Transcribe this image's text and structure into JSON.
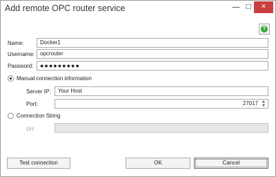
{
  "window": {
    "title": "Add remote OPC router service",
    "minimize_glyph": "—",
    "maximize_glyph": "□",
    "close_glyph": "✕"
  },
  "help": {
    "glyph": "?",
    "icon": "help-icon",
    "accent": "#31a531"
  },
  "form": {
    "name_label": "Name:",
    "name_value": "Docker1",
    "username_label": "Username:",
    "username_value": "opcrouter",
    "password_label": "Password:",
    "password_value": "●●●●●●●●●"
  },
  "manual": {
    "radio_label": "Manual connection information",
    "selected": true,
    "server_ip_label": "Server IP:",
    "server_ip_value": "Your Host",
    "port_label": "Port:",
    "port_value": "27017",
    "spin_up": "▲",
    "spin_down": "▼"
  },
  "connection_string": {
    "radio_label": "Connection String",
    "selected": false,
    "uri_label": "Uri:",
    "uri_value": ""
  },
  "buttons": {
    "test_connection": "Test connection",
    "ok": "OK",
    "cancel": "Cancel"
  },
  "colors": {
    "close_button": "#c94040",
    "border": "#a8a8a8"
  }
}
